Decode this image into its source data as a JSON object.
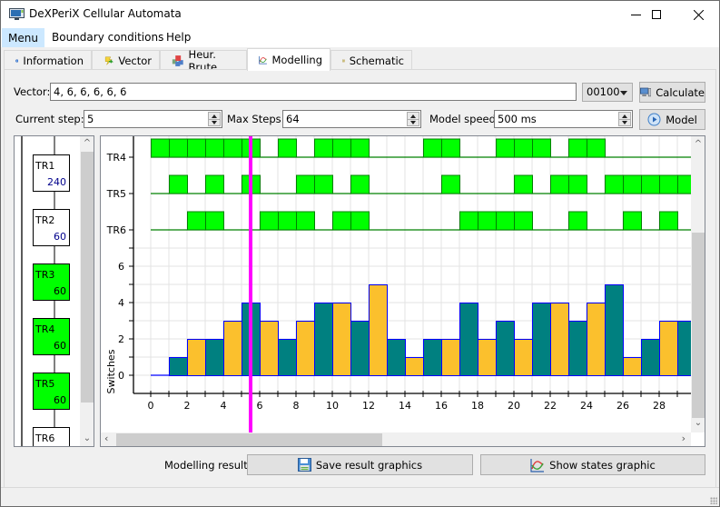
{
  "window": {
    "title": "DeXPeriX Cellular Automata",
    "controls": [
      "minimize",
      "maximize",
      "close"
    ]
  },
  "menubar": {
    "items": [
      {
        "label": "Menu",
        "active": true
      },
      {
        "label": "Boundary conditions",
        "active": false
      },
      {
        "label": "Help",
        "active": false
      }
    ]
  },
  "tabs": [
    {
      "label": "Information",
      "icon": "info-icon",
      "selected": false
    },
    {
      "label": "Vector",
      "icon": "vector-icon",
      "selected": false
    },
    {
      "label": "Heur. Brute",
      "icon": "cubes-icon",
      "selected": false
    },
    {
      "label": "Modelling",
      "icon": "chart-icon",
      "selected": true
    },
    {
      "label": "Schematic",
      "icon": "schematic-icon",
      "selected": false
    }
  ],
  "controls": {
    "vector_label": "Vector:",
    "vector_value": "4, 6, 6, 6, 6, 6",
    "rule_combo_value": "00100",
    "calculate_label": "Calculate",
    "current_step_label": "Current step:",
    "current_step_value": "5",
    "max_steps_label": "Max Steps:",
    "max_steps_value": "64",
    "model_speed_label": "Model speed:",
    "model_speed_value": "500 ms",
    "model_label": "Model"
  },
  "triggers": [
    {
      "name": "TR1",
      "value": "240",
      "active": false
    },
    {
      "name": "TR2",
      "value": "60",
      "active": false
    },
    {
      "name": "TR3",
      "value": "60",
      "active": true
    },
    {
      "name": "TR4",
      "value": "60",
      "active": true
    },
    {
      "name": "TR5",
      "value": "60",
      "active": true
    },
    {
      "name": "TR6",
      "value": "",
      "active": false
    }
  ],
  "footer": {
    "results_label": "Modelling results:",
    "save_label": "Save result graphics",
    "show_label": "Show states graphic"
  },
  "colors": {
    "pulse": "#00ff00",
    "pulse_border": "#008000",
    "bar_even": "#fbc02d",
    "bar_odd": "#008080",
    "bar_border": "#0000ff",
    "cursor": "#ff00ff",
    "trigger_active": "#00ff00"
  },
  "chart_data": {
    "type": "bar",
    "title": "",
    "xlabel": "",
    "ylabel": "Switches",
    "current_step_marker": 5.5,
    "x": [
      0,
      1,
      2,
      3,
      4,
      5,
      6,
      7,
      8,
      9,
      10,
      11,
      12,
      13,
      14,
      15,
      16,
      17,
      18,
      19,
      20,
      21,
      22,
      23,
      24,
      25,
      26,
      27,
      28,
      29
    ],
    "x_ticks": [
      0,
      2,
      4,
      6,
      8,
      10,
      12,
      14,
      16,
      18,
      20,
      22,
      24,
      26,
      28
    ],
    "y_ticks": [
      0,
      2,
      4,
      6
    ],
    "ylim": [
      -1,
      7
    ],
    "xlim": [
      -0.5,
      29.7
    ],
    "grid": true,
    "series": [
      {
        "name": "Switches",
        "values": [
          0,
          1,
          2,
          2,
          3,
          4,
          3,
          2,
          3,
          4,
          4,
          3,
          5,
          2,
          1,
          2,
          2,
          4,
          2,
          3,
          2,
          4,
          4,
          3,
          4,
          5,
          1,
          2,
          3,
          3
        ]
      }
    ],
    "timing": [
      {
        "name": "TR4",
        "states": [
          1,
          1,
          1,
          1,
          1,
          1,
          0,
          1,
          0,
          1,
          1,
          1,
          0,
          0,
          0,
          1,
          1,
          0,
          0,
          1,
          1,
          1,
          0,
          1,
          1,
          0,
          0,
          0,
          0,
          0
        ]
      },
      {
        "name": "TR5",
        "states": [
          0,
          1,
          0,
          1,
          0,
          1,
          0,
          0,
          1,
          1,
          0,
          1,
          0,
          0,
          0,
          0,
          1,
          0,
          0,
          0,
          1,
          0,
          1,
          1,
          0,
          1,
          1,
          1,
          1,
          1
        ]
      },
      {
        "name": "TR6",
        "states": [
          0,
          0,
          1,
          1,
          0,
          0,
          1,
          1,
          1,
          0,
          1,
          1,
          0,
          0,
          0,
          0,
          0,
          1,
          1,
          1,
          1,
          0,
          0,
          1,
          0,
          0,
          1,
          0,
          1,
          0
        ]
      }
    ]
  }
}
